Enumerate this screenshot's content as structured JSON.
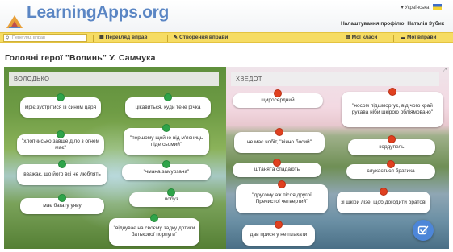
{
  "header": {
    "logo": "LearningApps.org",
    "language": "Українська",
    "profile": "Налаштування профілю: Наталія Зубик"
  },
  "nav": {
    "search_placeholder": "Перегляд вправ",
    "browse": "Перегляд вправ",
    "create": "Створення вправи",
    "classes": "Мої класи",
    "my_apps": "Мої вправи"
  },
  "page": {
    "title": "Головні герої \"Волинь\" У. Самчука"
  },
  "colors": {
    "left_pin": "#2fa44a",
    "right_pin": "#e0401f",
    "nav": "#f6dc63",
    "logo": "#5b86c4",
    "check": "#4d86d8"
  },
  "left": {
    "heading": "ВОЛОДЬКО",
    "cards": [
      "мріє зустрітися із сином царя",
      "цікавиться, куди тече річка",
      "\"хлопчисько завше діло з огнем має\"",
      "\"першому щойно від м'ясниць піде сьомий\"",
      "вважає, що його всі не люблять",
      "\"чмана замурзана\"",
      "має багату уяву",
      "лобуз",
      "\"відчуває на своєму задку дотики батькової порпуги\""
    ]
  },
  "right": {
    "heading": "ХВЕДОТ",
    "cards": [
      "щиросердний",
      "\"носом підшморгує, від чого край рукава ніби шкірою обліямовано\"",
      "не має чобіт, \"вічно босий\"",
      "кордупель",
      "штанята спадають",
      "слухається братика",
      "\"другому аж після другої Пречистої четвертий\"",
      "зі шкіри лізе, щоб догодити братові",
      "дав присягу не плакати"
    ]
  },
  "icons": {
    "search": "search-icon",
    "grid": "grid-icon",
    "pencil": "pencil-icon",
    "classes": "classes-icon",
    "folder": "folder-icon",
    "check": "check-icon",
    "resize": "resize-icon"
  }
}
